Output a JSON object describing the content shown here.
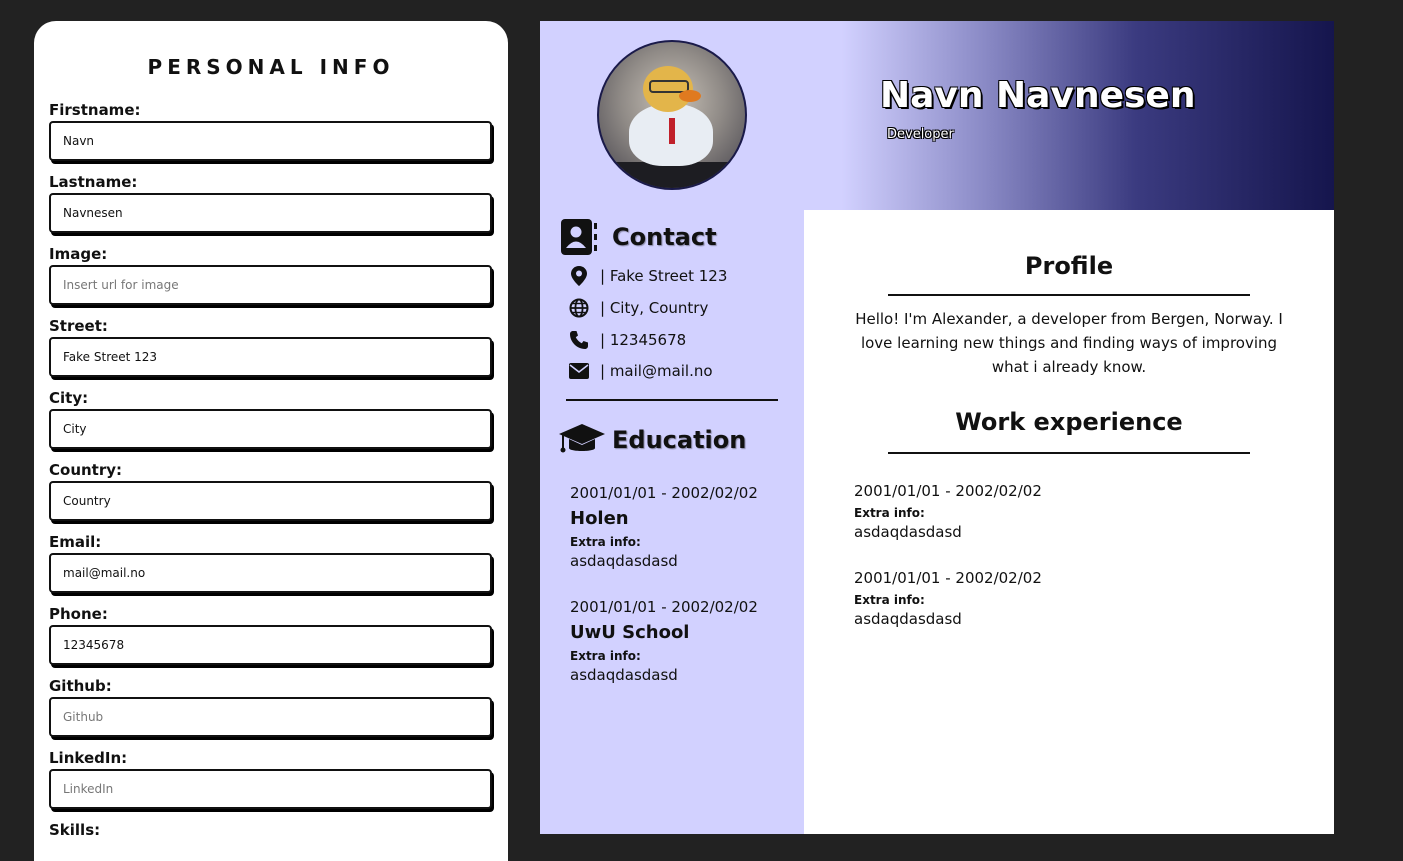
{
  "form": {
    "title": "PERSONAL INFO",
    "fields": [
      {
        "label": "Firstname:",
        "value": "Navn",
        "placeholder": ""
      },
      {
        "label": "Lastname:",
        "value": "Navnesen",
        "placeholder": ""
      },
      {
        "label": "Image:",
        "value": "",
        "placeholder": "Insert url for image"
      },
      {
        "label": "Street:",
        "value": "Fake Street 123",
        "placeholder": ""
      },
      {
        "label": "City:",
        "value": "City",
        "placeholder": ""
      },
      {
        "label": "Country:",
        "value": "Country",
        "placeholder": ""
      },
      {
        "label": "Email:",
        "value": "mail@mail.no",
        "placeholder": ""
      },
      {
        "label": "Phone:",
        "value": "12345678",
        "placeholder": ""
      },
      {
        "label": "Github:",
        "value": "",
        "placeholder": "Github"
      },
      {
        "label": "LinkedIn:",
        "value": "",
        "placeholder": "LinkedIn"
      },
      {
        "label": "Skills:",
        "value": "",
        "placeholder": ""
      }
    ]
  },
  "cv": {
    "name": "Navn Navnesen",
    "role": "Developer",
    "contact": {
      "title": "Contact",
      "rows": [
        {
          "icon": "location-pin-icon",
          "text": "| Fake Street 123"
        },
        {
          "icon": "globe-icon",
          "text": "| City, Country"
        },
        {
          "icon": "phone-icon",
          "text": "| 12345678"
        },
        {
          "icon": "envelope-icon",
          "text": "| mail@mail.no"
        }
      ]
    },
    "education": {
      "title": "Education",
      "items": [
        {
          "date": "2001/01/01 - 2002/02/02",
          "school": "Holen",
          "extra_label": "Extra info:",
          "extra": "asdaqdasdasd"
        },
        {
          "date": "2001/01/01 - 2002/02/02",
          "school": "UwU School",
          "extra_label": "Extra info:",
          "extra": "asdaqdasdasd"
        }
      ]
    },
    "profile": {
      "title": "Profile",
      "text": "Hello! I'm Alexander, a developer from Bergen, Norway. I love learning new things and finding ways of improving what i already know."
    },
    "work": {
      "title": "Work experience",
      "items": [
        {
          "date": "2001/01/01 - 2002/02/02",
          "extra_label": "Extra info:",
          "extra": "asdaqdasdasd"
        },
        {
          "date": "2001/01/01 - 2002/02/02",
          "extra_label": "Extra info:",
          "extra": "asdaqdasdasd"
        }
      ]
    }
  },
  "colors": {
    "background": "#222222",
    "sidebar": "#d2d1ff",
    "header_dark": "#15154d"
  }
}
